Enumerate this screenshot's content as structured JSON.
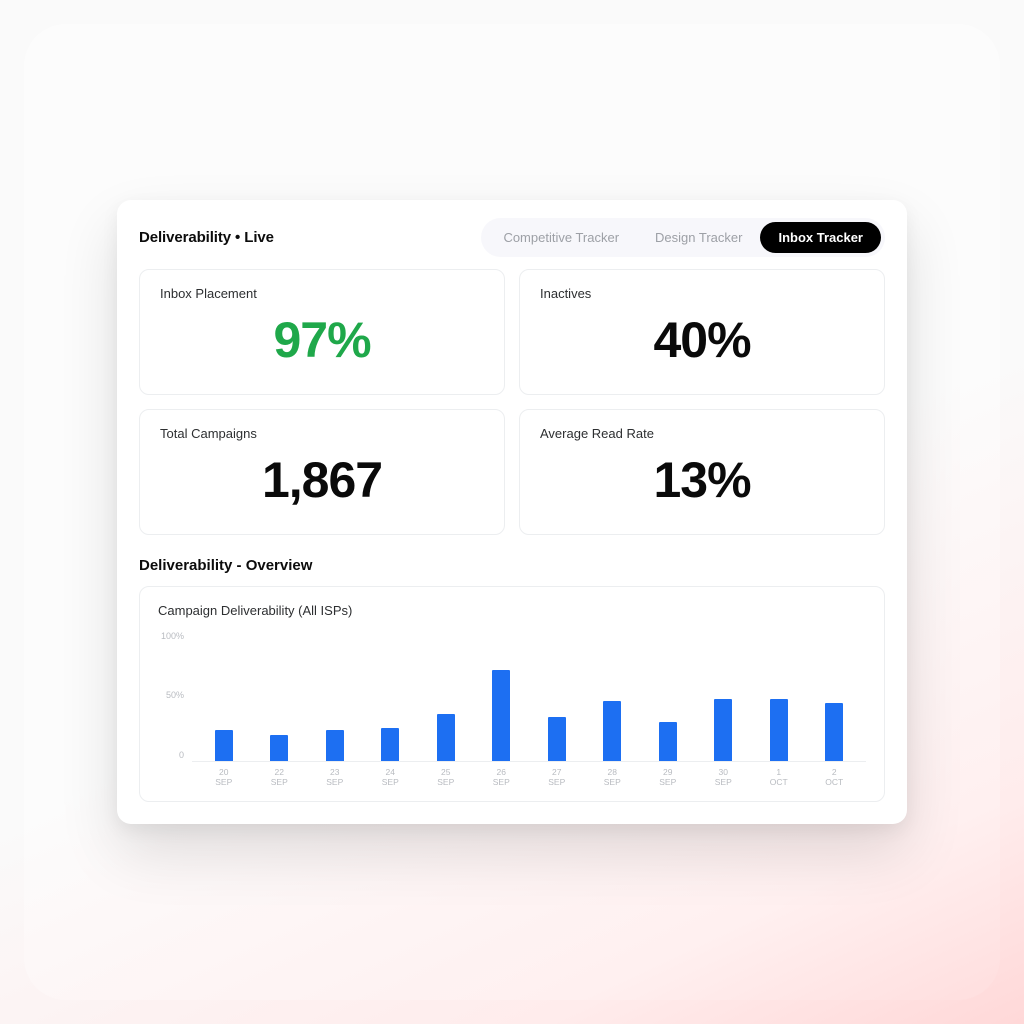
{
  "header": {
    "title": "Deliverability • Live"
  },
  "tabs": [
    {
      "label": "Competitive Tracker",
      "active": false
    },
    {
      "label": "Design Tracker",
      "active": false
    },
    {
      "label": "Inbox Tracker",
      "active": true
    }
  ],
  "stats": {
    "inbox_placement": {
      "label": "Inbox Placement",
      "value": "97%",
      "color": "green"
    },
    "inactives": {
      "label": "Inactives",
      "value": "40%"
    },
    "total_campaigns": {
      "label": "Total Campaigns",
      "value": "1,867"
    },
    "avg_read_rate": {
      "label": "Average Read Rate",
      "value": "13%"
    }
  },
  "overview": {
    "title": "Deliverability - Overview"
  },
  "chart_data": {
    "type": "bar",
    "title": "Campaign Deliverability (All ISPs)",
    "ylabel": "",
    "xlabel": "",
    "ylim": [
      0,
      100
    ],
    "y_ticks": [
      "100%",
      "50%",
      "0"
    ],
    "categories": [
      {
        "day": "20",
        "mon": "SEP"
      },
      {
        "day": "22",
        "mon": "SEP"
      },
      {
        "day": "23",
        "mon": "SEP"
      },
      {
        "day": "24",
        "mon": "SEP"
      },
      {
        "day": "25",
        "mon": "SEP"
      },
      {
        "day": "26",
        "mon": "SEP"
      },
      {
        "day": "27",
        "mon": "SEP"
      },
      {
        "day": "28",
        "mon": "SEP"
      },
      {
        "day": "29",
        "mon": "SEP"
      },
      {
        "day": "30",
        "mon": "SEP"
      },
      {
        "day": "1",
        "mon": "OCT"
      },
      {
        "day": "2",
        "mon": "OCT"
      }
    ],
    "values": [
      24,
      20,
      24,
      25,
      36,
      70,
      34,
      46,
      30,
      48,
      48,
      45
    ],
    "bar_color": "#1d6ff2"
  }
}
